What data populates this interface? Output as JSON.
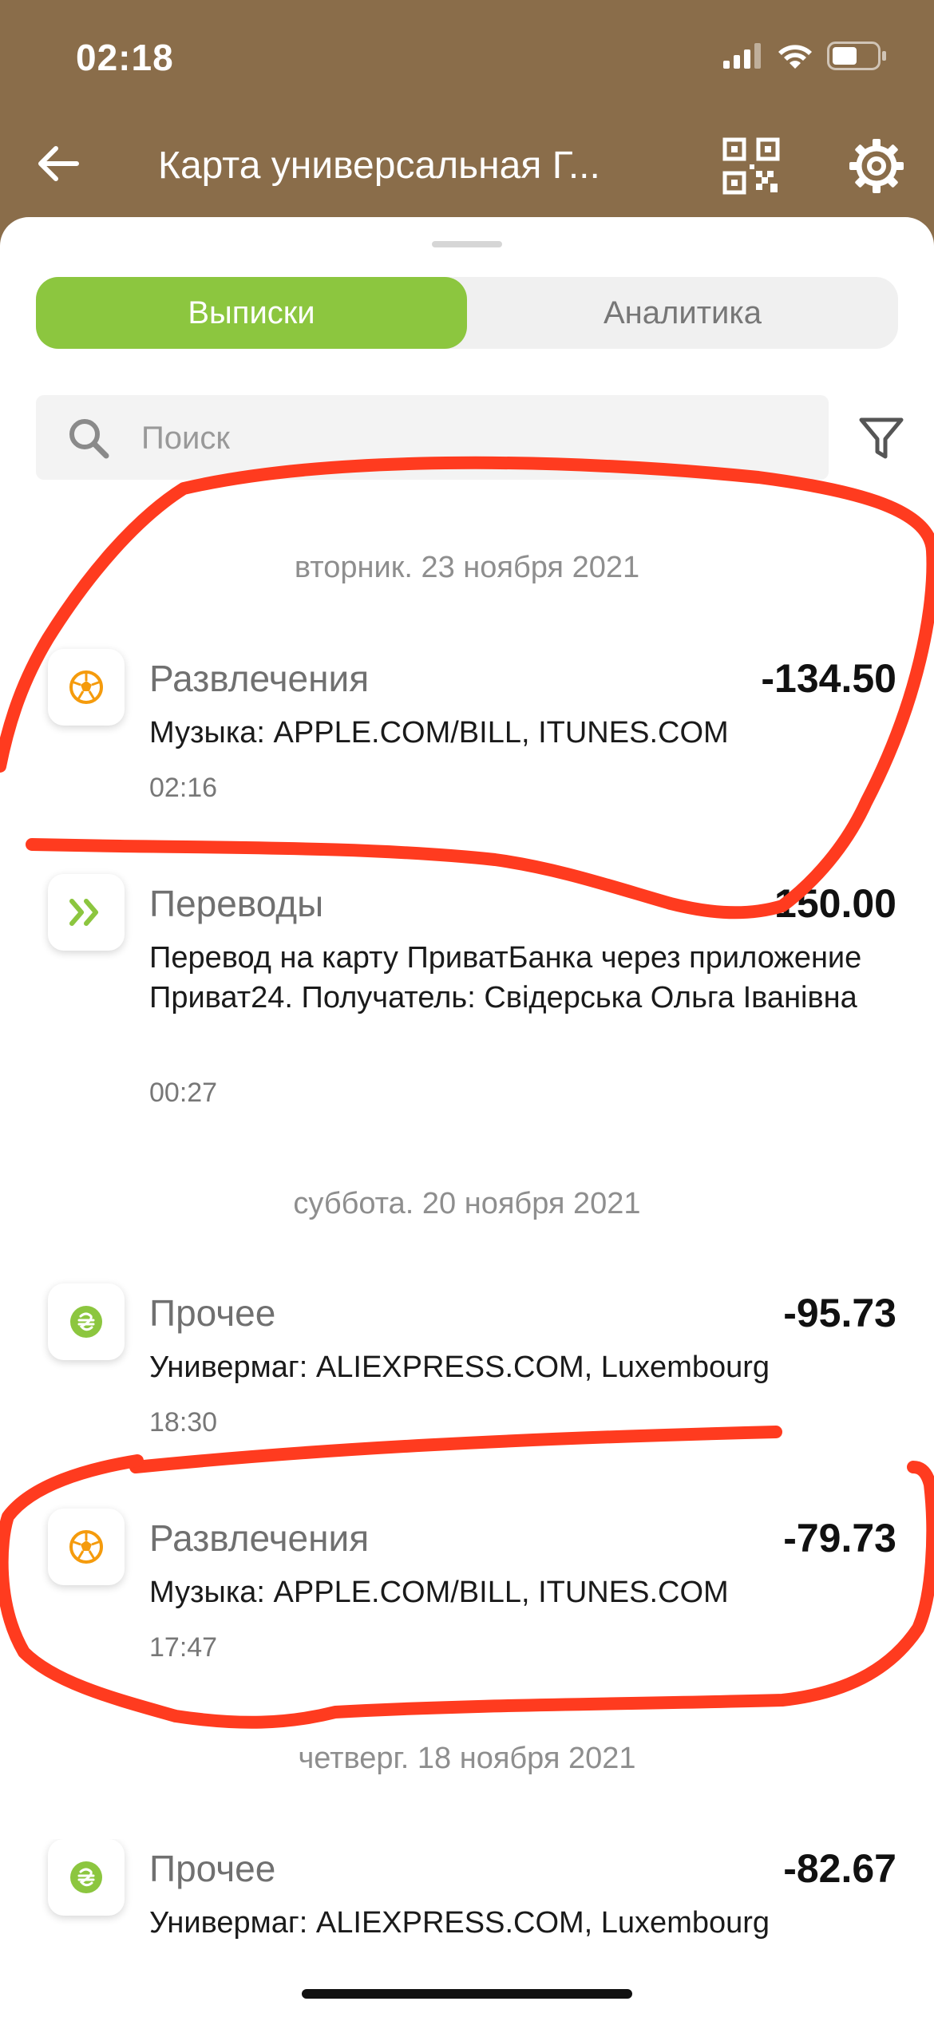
{
  "status": {
    "time": "02:18"
  },
  "nav": {
    "title": "Карта универсальная Г..."
  },
  "tabs": [
    {
      "label": "Выписки",
      "active": true
    },
    {
      "label": "Аналитика",
      "active": false
    }
  ],
  "search": {
    "placeholder": "Поиск",
    "value": ""
  },
  "groups": [
    {
      "date": "вторник. 23 ноября 2021",
      "transactions": [
        {
          "category": "Развлечения",
          "amount": "-134.50",
          "description": "Музыка: APPLE.COM/BILL, ITUNES.COM",
          "time": "02:16",
          "icon": "soccer-ball-icon"
        },
        {
          "category": "Переводы",
          "amount": "-150.00",
          "description": "Перевод на карту ПриватБанка через приложение Приват24. Получатель: Свідерська Ольга Іванівна",
          "time": "00:27",
          "icon": "double-chevron-icon"
        }
      ]
    },
    {
      "date": "суббота. 20 ноября 2021",
      "transactions": [
        {
          "category": "Прочее",
          "amount": "-95.73",
          "description": "Универмаг: ALIEXPRESS.COM, Luxembourg",
          "time": "18:30",
          "icon": "hryvnia-icon"
        },
        {
          "category": "Развлечения",
          "amount": "-79.73",
          "description": "Музыка: APPLE.COM/BILL, ITUNES.COM",
          "time": "17:47",
          "icon": "soccer-ball-icon"
        }
      ]
    },
    {
      "date": "четверг. 18 ноября 2021",
      "transactions": [
        {
          "category": "Прочее",
          "amount": "-82.67",
          "description": "Универмаг: ALIEXPRESS.COM, Luxembourg",
          "time": "",
          "icon": "hryvnia-icon"
        }
      ]
    }
  ],
  "colors": {
    "header": "#8a6d4a",
    "accent": "#8cc63f",
    "annotation": "#ff3b1f"
  }
}
